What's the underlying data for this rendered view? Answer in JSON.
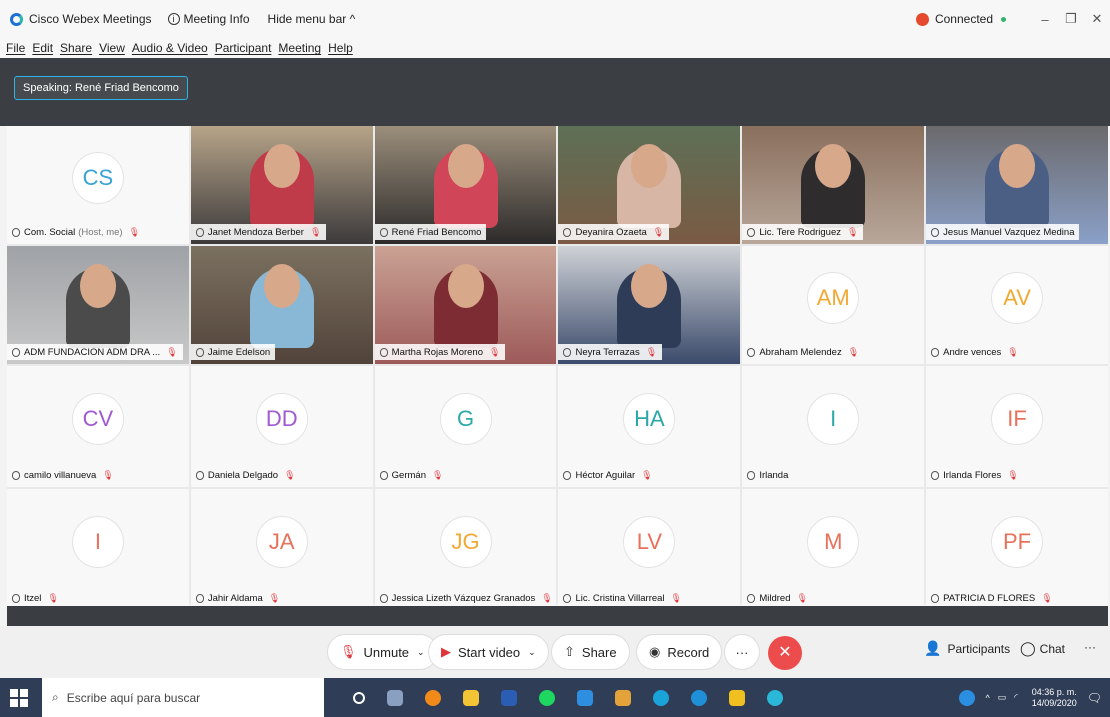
{
  "window": {
    "app_name": "Cisco Webex Meetings",
    "meeting_info": "Meeting Info",
    "hide_menu": "Hide menu bar ^",
    "status": "Connected"
  },
  "menu": [
    "File",
    "Edit",
    "Share",
    "View",
    "Audio & Video",
    "Participant",
    "Meeting",
    "Help"
  ],
  "speaking": "Speaking: René Friad Bencomo",
  "participants": [
    {
      "name": "Com. Social",
      "suffix": "(Host, me)",
      "initials": "CS",
      "color": "#3aa3d6",
      "muted": true
    },
    {
      "name": "Janet Mendoza Berber",
      "video": true,
      "muted": true
    },
    {
      "name": "René Friad Bencomo",
      "video": true,
      "active": true
    },
    {
      "name": "Deyanira Ozaeta",
      "video": true,
      "muted": true
    },
    {
      "name": "Lic. Tere Rodriguez",
      "video": true,
      "muted": true
    },
    {
      "name": "Jesus Manuel Vazquez Medina",
      "video": true
    },
    {
      "name": "ADM FUNDACION ADM DRA ...",
      "video": true,
      "muted": true
    },
    {
      "name": "Jaime Edelson",
      "video": true
    },
    {
      "name": "Martha Rojas Moreno",
      "video": true,
      "muted": true
    },
    {
      "name": "Neyra Terrazas",
      "video": true,
      "muted": true
    },
    {
      "name": "Abraham Melendez",
      "initials": "AM",
      "color": "#f2a933",
      "muted": true
    },
    {
      "name": "Andre vences",
      "initials": "AV",
      "color": "#f2a933",
      "muted": true
    },
    {
      "name": "camilo villanueva",
      "initials": "CV",
      "color": "#a05ad0",
      "muted": true
    },
    {
      "name": "Daniela Delgado",
      "initials": "DD",
      "color": "#a05ad0",
      "muted": true
    },
    {
      "name": "Germán",
      "initials": "G",
      "color": "#2ba8a8",
      "muted": true
    },
    {
      "name": "Héctor Aguilar",
      "initials": "HA",
      "color": "#2ba8a8",
      "muted": true
    },
    {
      "name": "Irlanda",
      "initials": "I",
      "color": "#2ba8a8",
      "muted": false
    },
    {
      "name": "Irlanda Flores",
      "initials": "IF",
      "color": "#e9705a",
      "muted": true
    },
    {
      "name": "Itzel",
      "initials": "I",
      "color": "#e9705a",
      "muted": true
    },
    {
      "name": "Jahir Aldama",
      "initials": "JA",
      "color": "#e9705a",
      "muted": true
    },
    {
      "name": "Jessica Lizeth Vázquez Granados",
      "initials": "JG",
      "color": "#f2a933",
      "muted": true
    },
    {
      "name": "Lic. Cristina Villarreal",
      "initials": "LV",
      "color": "#e9705a",
      "muted": true
    },
    {
      "name": "Mildred",
      "initials": "M",
      "color": "#e9705a",
      "muted": true
    },
    {
      "name": "PATRICIA D FLORES",
      "initials": "PF",
      "color": "#e9705a",
      "muted": true
    }
  ],
  "toolbar": {
    "unmute": "Unmute",
    "start_video": "Start video",
    "share": "Share",
    "record": "Record",
    "more": "···",
    "participants": "Participants",
    "chat": "Chat",
    "overflow": "···"
  },
  "taskbar": {
    "search_placeholder": "Escribe aquí para buscar",
    "time": "04:36 p. m.",
    "date": "14/09/2020"
  }
}
